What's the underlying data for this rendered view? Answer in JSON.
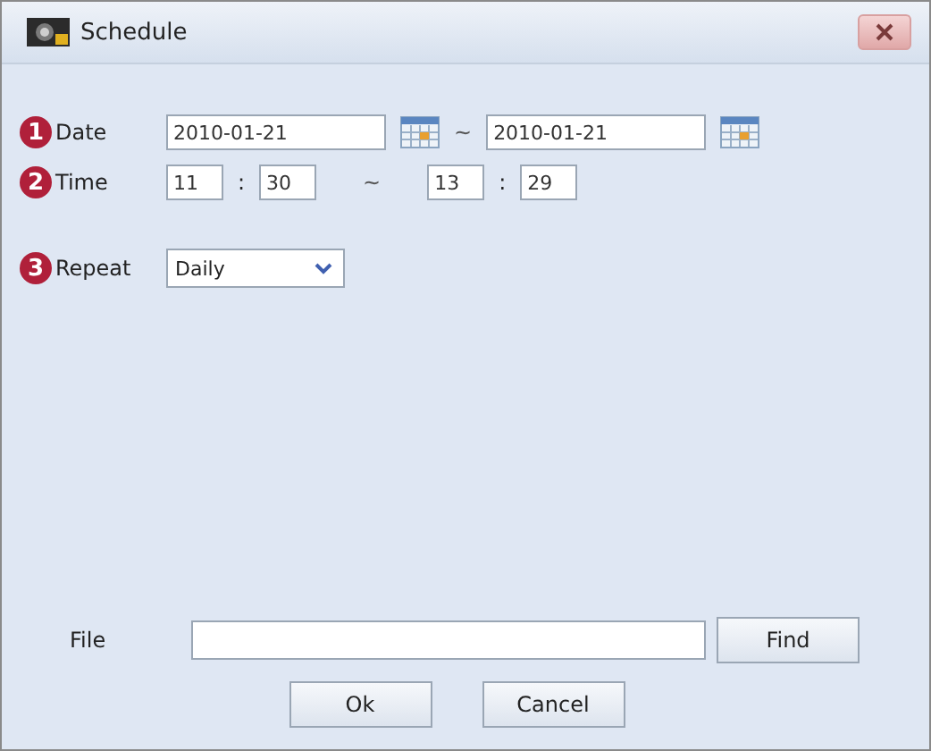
{
  "window": {
    "title": "Schedule"
  },
  "date": {
    "marker": "1",
    "label": "Date",
    "from": "2010-01-21",
    "separator": "~",
    "to": "2010-01-21"
  },
  "time": {
    "marker": "2",
    "label": "Time",
    "from_hour": "11",
    "from_colon": ":",
    "from_minute": "30",
    "separator": "~",
    "to_hour": "13",
    "to_colon": ":",
    "to_minute": "29"
  },
  "repeat": {
    "marker": "3",
    "label": "Repeat",
    "value": "Daily"
  },
  "file": {
    "label": "File",
    "button": "Find"
  },
  "buttons": [
    "Ok",
    "Cancel"
  ]
}
